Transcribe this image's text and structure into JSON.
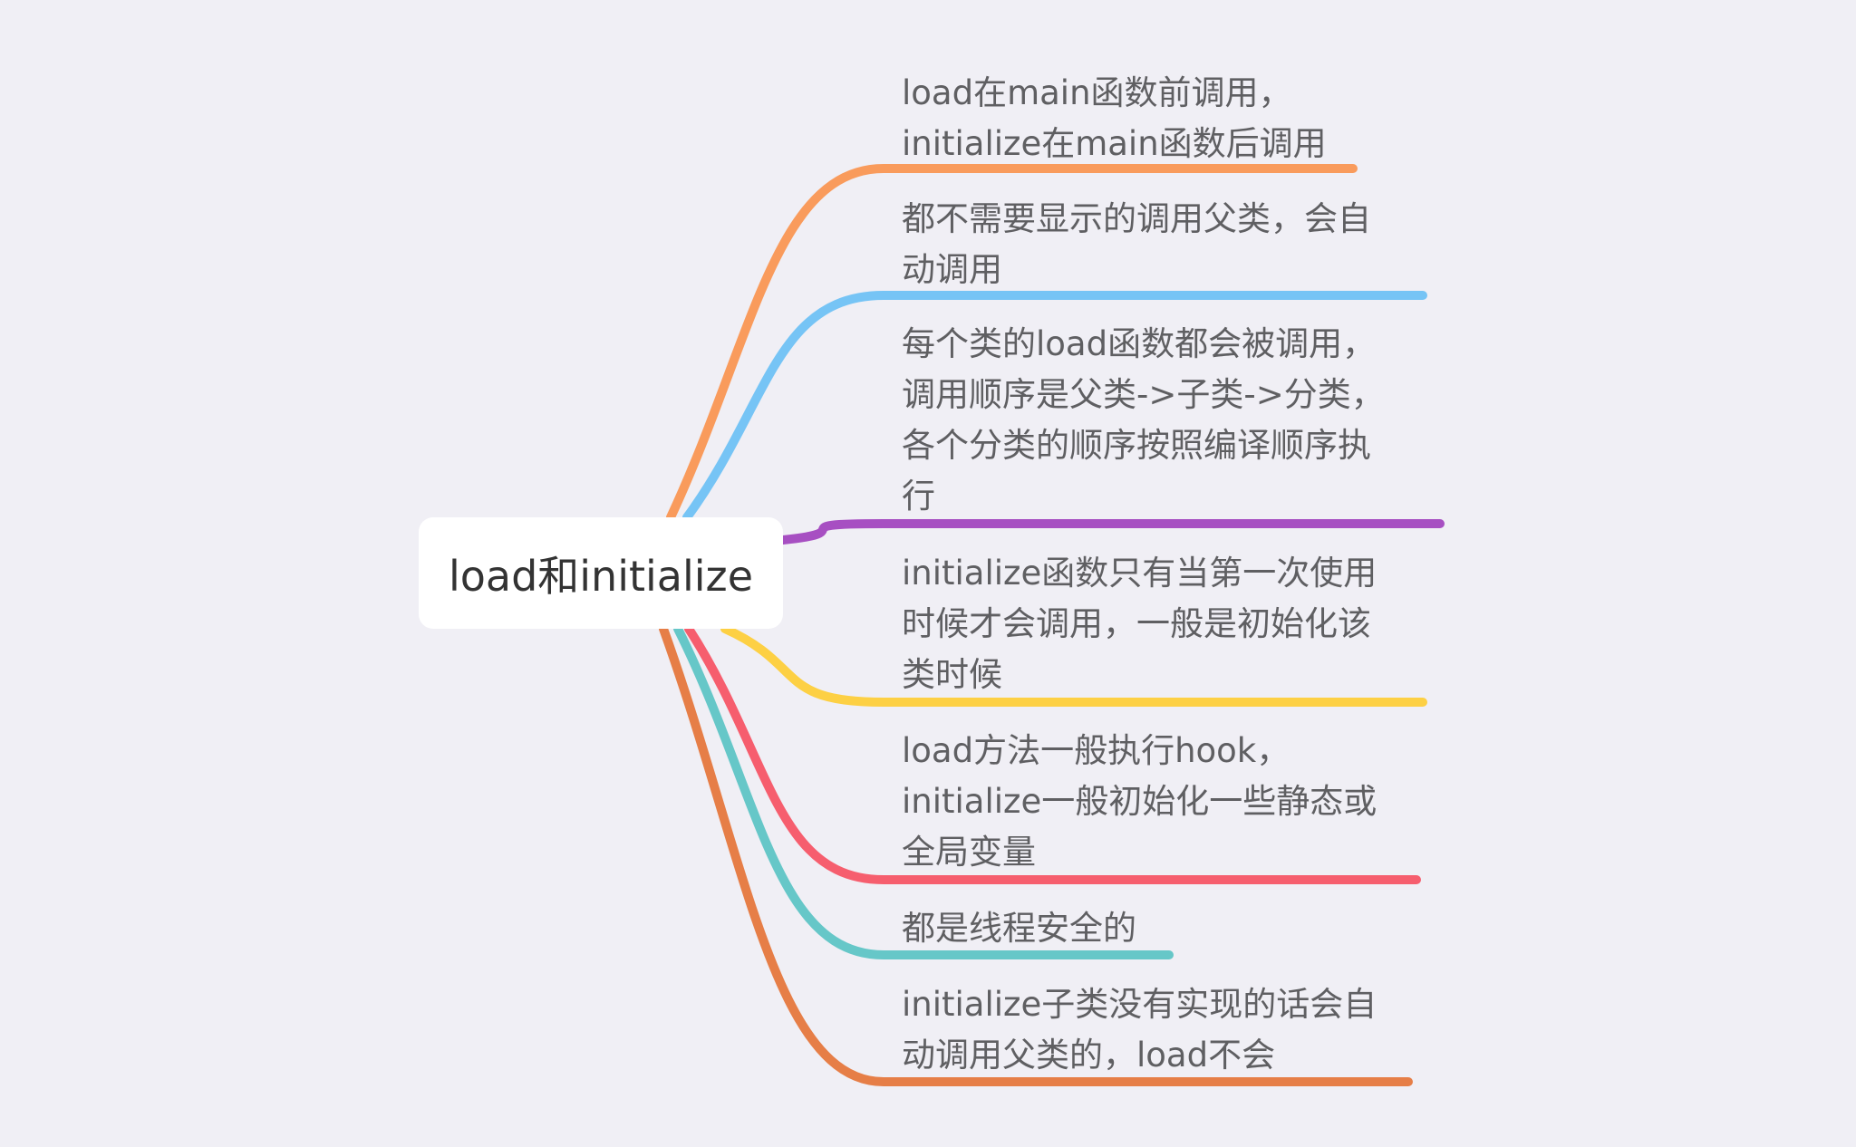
{
  "root": {
    "label": "load和initialize"
  },
  "branches": [
    {
      "text": "load在main函数前调用，\ninitialize在main函数后调用",
      "color": "#f99b5c"
    },
    {
      "text": "都不需要显示的调用父类，会自\n动调用",
      "color": "#76c4f5"
    },
    {
      "text": "每个类的load函数都会被调用，\n调用顺序是父类->子类->分类，\n各个分类的顺序按照编译顺序执\n行",
      "color": "#a74fc2"
    },
    {
      "text": "initialize函数只有当第一次使用\n时候才会调用，一般是初始化该\n类时候",
      "color": "#fdd044"
    },
    {
      "text": "load方法一般执行hook，\ninitialize一般初始化一些静态或\n全局变量",
      "color": "#f65e6e"
    },
    {
      "text": "都是线程安全的",
      "color": "#66c7c8"
    },
    {
      "text": "initialize子类没有实现的话会自\n动调用父类的，load不会",
      "color": "#e67e47"
    }
  ]
}
